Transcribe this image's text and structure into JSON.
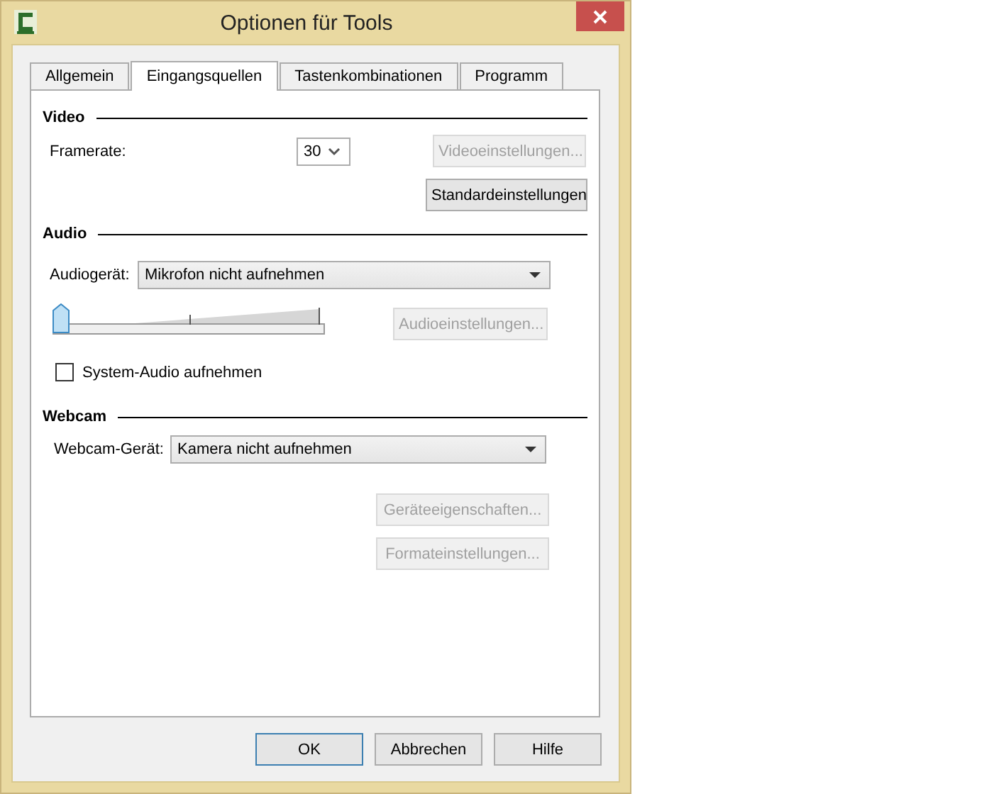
{
  "window": {
    "title": "Optionen für Tools"
  },
  "tabs": [
    {
      "label": "Allgemein",
      "selected": false
    },
    {
      "label": "Eingangsquellen",
      "selected": true
    },
    {
      "label": "Tastenkombinationen",
      "selected": false
    },
    {
      "label": "Programm",
      "selected": false
    }
  ],
  "video": {
    "heading": "Video",
    "framerate": {
      "label": "Framerate:",
      "value": "30"
    },
    "settings_button": {
      "label": "Videoeinstellungen...",
      "disabled": true
    },
    "defaults_button": {
      "label": "Standardeinstellungen",
      "disabled": false
    }
  },
  "audio": {
    "heading": "Audio",
    "device": {
      "label": "Audiogerät:",
      "value": "Mikrofon nicht aufnehmen"
    },
    "volume": {
      "level": 0
    },
    "settings_button": {
      "label": "Audioeinstellungen...",
      "disabled": true
    },
    "system_audio": {
      "label": "System-Audio aufnehmen",
      "checked": false
    }
  },
  "webcam": {
    "heading": "Webcam",
    "device": {
      "label": "Webcam-Gerät:",
      "value": "Kamera nicht aufnehmen"
    },
    "buttons": [
      {
        "label": "Geräteeigenschaften...",
        "disabled": true
      },
      {
        "label": "Formateinstellungen...",
        "disabled": true
      }
    ]
  },
  "buttons": [
    {
      "label": "OK",
      "default": true
    },
    {
      "label": "Abbrechen",
      "default": false
    },
    {
      "label": "Hilfe",
      "default": false
    }
  ]
}
